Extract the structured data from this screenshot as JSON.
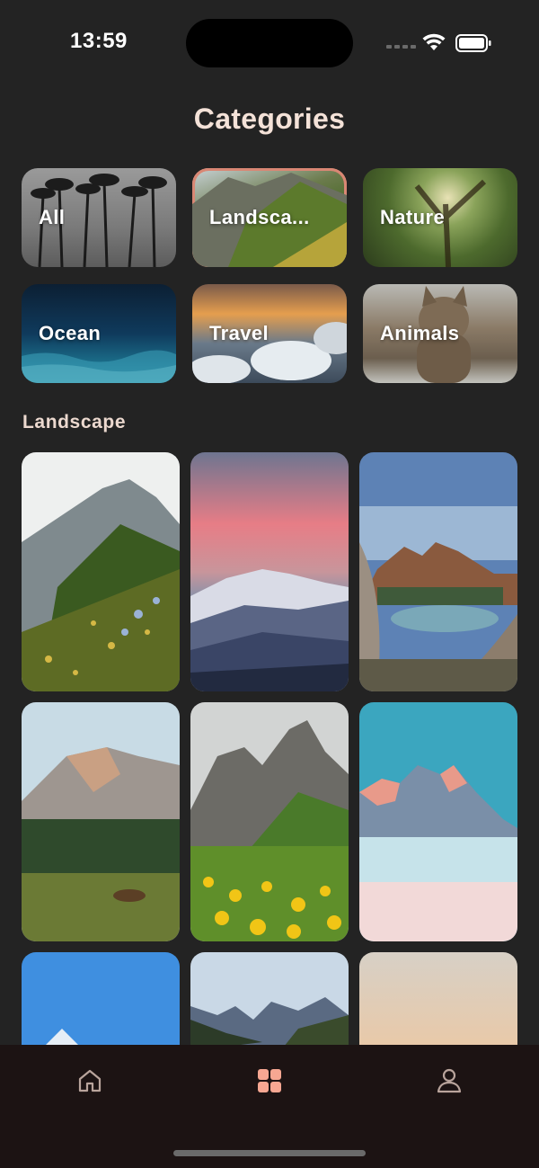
{
  "status_bar": {
    "time": "13:59"
  },
  "header": {
    "title": "Categories"
  },
  "categories": [
    {
      "label": "All",
      "selected": false
    },
    {
      "label": "Landsca...",
      "selected": true
    },
    {
      "label": "Nature",
      "selected": false
    },
    {
      "label": "Ocean",
      "selected": false
    },
    {
      "label": "Travel",
      "selected": false
    },
    {
      "label": "Animals",
      "selected": false
    }
  ],
  "section": {
    "title": "Landscape"
  },
  "photos": [
    {
      "icon": "mountain-wildflower-photo"
    },
    {
      "icon": "pink-sky-mountain-photo"
    },
    {
      "icon": "lake-driftwood-photo"
    },
    {
      "icon": "yosemite-deer-photo"
    },
    {
      "icon": "dolomites-dandelion-photo"
    },
    {
      "icon": "snowy-peaks-photo"
    },
    {
      "icon": "blue-sky-peak-photo"
    },
    {
      "icon": "alpine-range-photo"
    },
    {
      "icon": "pastel-sky-photo"
    }
  ],
  "tab_bar": {
    "items": [
      {
        "icon": "home-icon",
        "active": false
      },
      {
        "icon": "grid-icon",
        "active": true
      },
      {
        "icon": "profile-icon",
        "active": false
      }
    ]
  },
  "colors": {
    "background": "#232323",
    "accent": "#f7a792",
    "selected_border": "#d98774",
    "tab_bar": "#1c1313",
    "inactive_icon": "#b9a49c"
  }
}
